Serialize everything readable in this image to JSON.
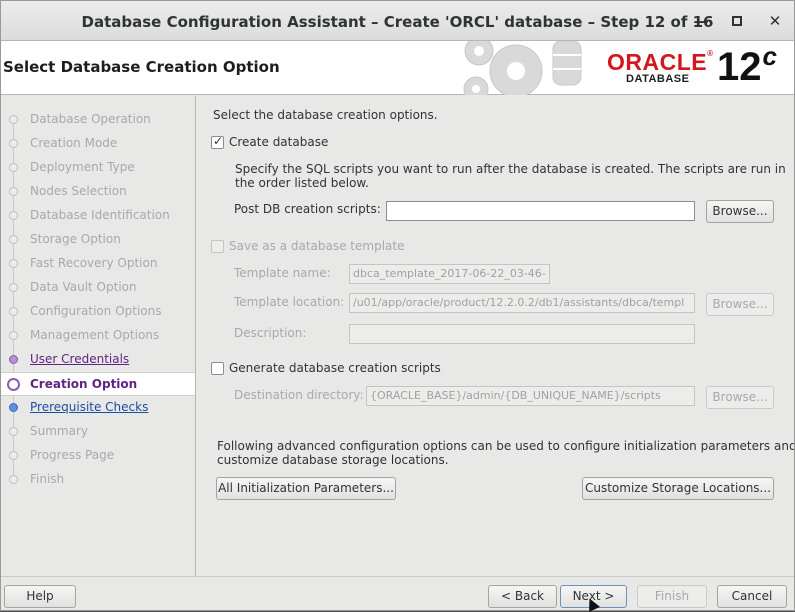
{
  "window": {
    "title": "Database Configuration Assistant – Create 'ORCL' database – Step 12 of 16",
    "minimize": "—",
    "close": "✕"
  },
  "banner": {
    "page_title": "Select Database Creation Option",
    "logo_brand": "ORACLE",
    "logo_reg": "®",
    "logo_product": "DATABASE",
    "version_major": "12",
    "version_suffix": "c"
  },
  "nav": {
    "items": [
      {
        "label": "Database Operation",
        "state": "done"
      },
      {
        "label": "Creation Mode",
        "state": "done"
      },
      {
        "label": "Deployment Type",
        "state": "done"
      },
      {
        "label": "Nodes Selection",
        "state": "done"
      },
      {
        "label": "Database Identification",
        "state": "done"
      },
      {
        "label": "Storage Option",
        "state": "done"
      },
      {
        "label": "Fast Recovery Option",
        "state": "done"
      },
      {
        "label": "Data Vault Option",
        "state": "done"
      },
      {
        "label": "Configuration Options",
        "state": "done"
      },
      {
        "label": "Management Options",
        "state": "done"
      },
      {
        "label": "User Credentials",
        "state": "visited"
      },
      {
        "label": "Creation Option",
        "state": "current"
      },
      {
        "label": "Prerequisite Checks",
        "state": "next"
      },
      {
        "label": "Summary",
        "state": "pending"
      },
      {
        "label": "Progress Page",
        "state": "pending"
      },
      {
        "label": "Finish",
        "state": "pending"
      }
    ]
  },
  "content": {
    "intro": "Select the database creation options.",
    "create_db_label": "Create database",
    "create_db_checked": true,
    "scripts_desc_line1": "Specify the SQL scripts you want to run after the database is created. The scripts are run in",
    "scripts_desc_line2": "the order listed below.",
    "post_scripts_label": "Post DB creation scripts:",
    "post_scripts_value": "",
    "browse_label": "Browse...",
    "save_template_label": "Save as a database template",
    "template_name_label": "Template name:",
    "template_name_value": "dbca_template_2017-06-22_03-46-",
    "template_location_label": "Template location:",
    "template_location_value": "/u01/app/oracle/product/12.2.0.2/db1/assistants/dbca/templ",
    "description_label": "Description:",
    "description_value": "",
    "gen_scripts_label": "Generate database creation scripts",
    "dest_dir_label": "Destination directory:",
    "dest_dir_value": "{ORACLE_BASE}/admin/{DB_UNIQUE_NAME}/scripts",
    "advanced_line1": "Following advanced configuration options can be used to configure initialization parameters and",
    "advanced_line2": "customize database storage locations.",
    "init_params_button": "All Initialization Parameters...",
    "storage_locations_button": "Customize Storage Locations..."
  },
  "footer": {
    "help": "Help",
    "back": "< Back",
    "next": "Next >",
    "finish": "Finish",
    "cancel": "Cancel"
  }
}
